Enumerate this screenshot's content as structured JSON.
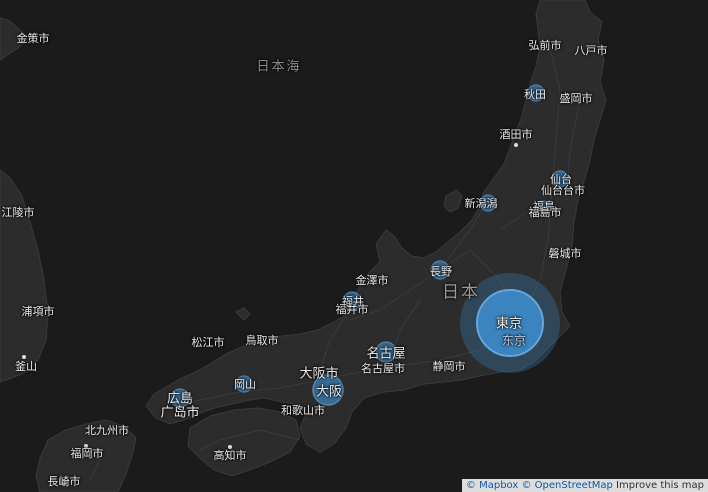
{
  "colors": {
    "land": "#2c2c2c",
    "water": "#1b1b1b",
    "bubble": "#3d8fd1",
    "bubble_edge": "#6fb6ef",
    "coast": "#3a3a3a",
    "roads": "#444444"
  },
  "labels": {
    "sea_japan": "日本海",
    "country_japan": "日本",
    "jinchaek": "金策市",
    "hirosaki": "弘前市",
    "hachinohe": "八戸市",
    "akita": "秋田",
    "morioka": "盛岡市",
    "sakata": "酒田市",
    "sendai": "仙台",
    "sendai_shi": "仙台台市",
    "niigata": "新潟潟",
    "fukushima": "福島",
    "fukushima_shi": "福島市",
    "iwaki": "磐城市",
    "gangneung": "江陵市",
    "pohang": "浦項市",
    "busan": "釜山",
    "nagano": "長野",
    "kanazawa": "金澤市",
    "fukui": "福井",
    "fukui_shi": "福井市",
    "tokyo": "東京",
    "tokyo_sub": "东京",
    "matsue": "松江市",
    "tottori": "鳥取市",
    "nagoya": "名古屋",
    "nagoya_shi": "名古屋市",
    "shizuoka": "静岡市",
    "osaka_shi": "大阪市",
    "osaka": "大阪",
    "wakayama": "和歌山市",
    "okayama": "岡山",
    "hiroshima": "広島",
    "hiroshima_cn": "广岛市",
    "kitakyushu": "北九州市",
    "fukuoka": "福岡市",
    "kochi": "高知市",
    "nagasaki": "長崎市"
  },
  "bubbles": [
    {
      "id": "tokyo",
      "level": 100
    },
    {
      "id": "osaka",
      "level": 30
    },
    {
      "id": "nagoya",
      "level": 15
    },
    {
      "id": "fukui",
      "level": 10
    },
    {
      "id": "nagano",
      "level": 10
    },
    {
      "id": "niigata",
      "level": 8
    },
    {
      "id": "sendai",
      "level": 7
    },
    {
      "id": "akita",
      "level": 6
    },
    {
      "id": "hiroshima",
      "level": 10
    },
    {
      "id": "okayama",
      "level": 7
    },
    {
      "id": "fukushima",
      "level": 6
    }
  ],
  "attribution": {
    "mapbox": "© Mapbox",
    "osm": "© OpenStreetMap",
    "improve": "Improve this map"
  }
}
